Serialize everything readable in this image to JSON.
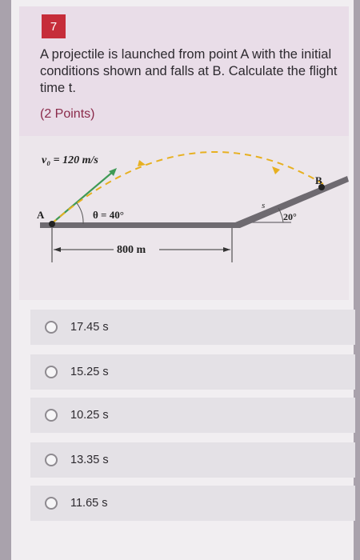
{
  "question": {
    "number": "7",
    "text": "A projectile is launched from point A with the initial conditions shown and falls at B. Calculate the flight time t.",
    "points": "(2 Points)"
  },
  "figure": {
    "velocity_label": "v₀ = 120 m/s",
    "point_a": "A",
    "angle_label": "θ = 40°",
    "distance_label": "800 m",
    "s_label": "s",
    "incline_angle": "20°",
    "point_b": "B"
  },
  "options": [
    {
      "label": "17.45 s"
    },
    {
      "label": "15.25 s"
    },
    {
      "label": "10.25 s"
    },
    {
      "label": "13.35 s"
    },
    {
      "label": "11.65 s"
    }
  ],
  "colors": {
    "accent": "#c62d3a",
    "card": "#e9dde8",
    "trajectory": "#e7b020",
    "velocity": "#3f9a55"
  }
}
